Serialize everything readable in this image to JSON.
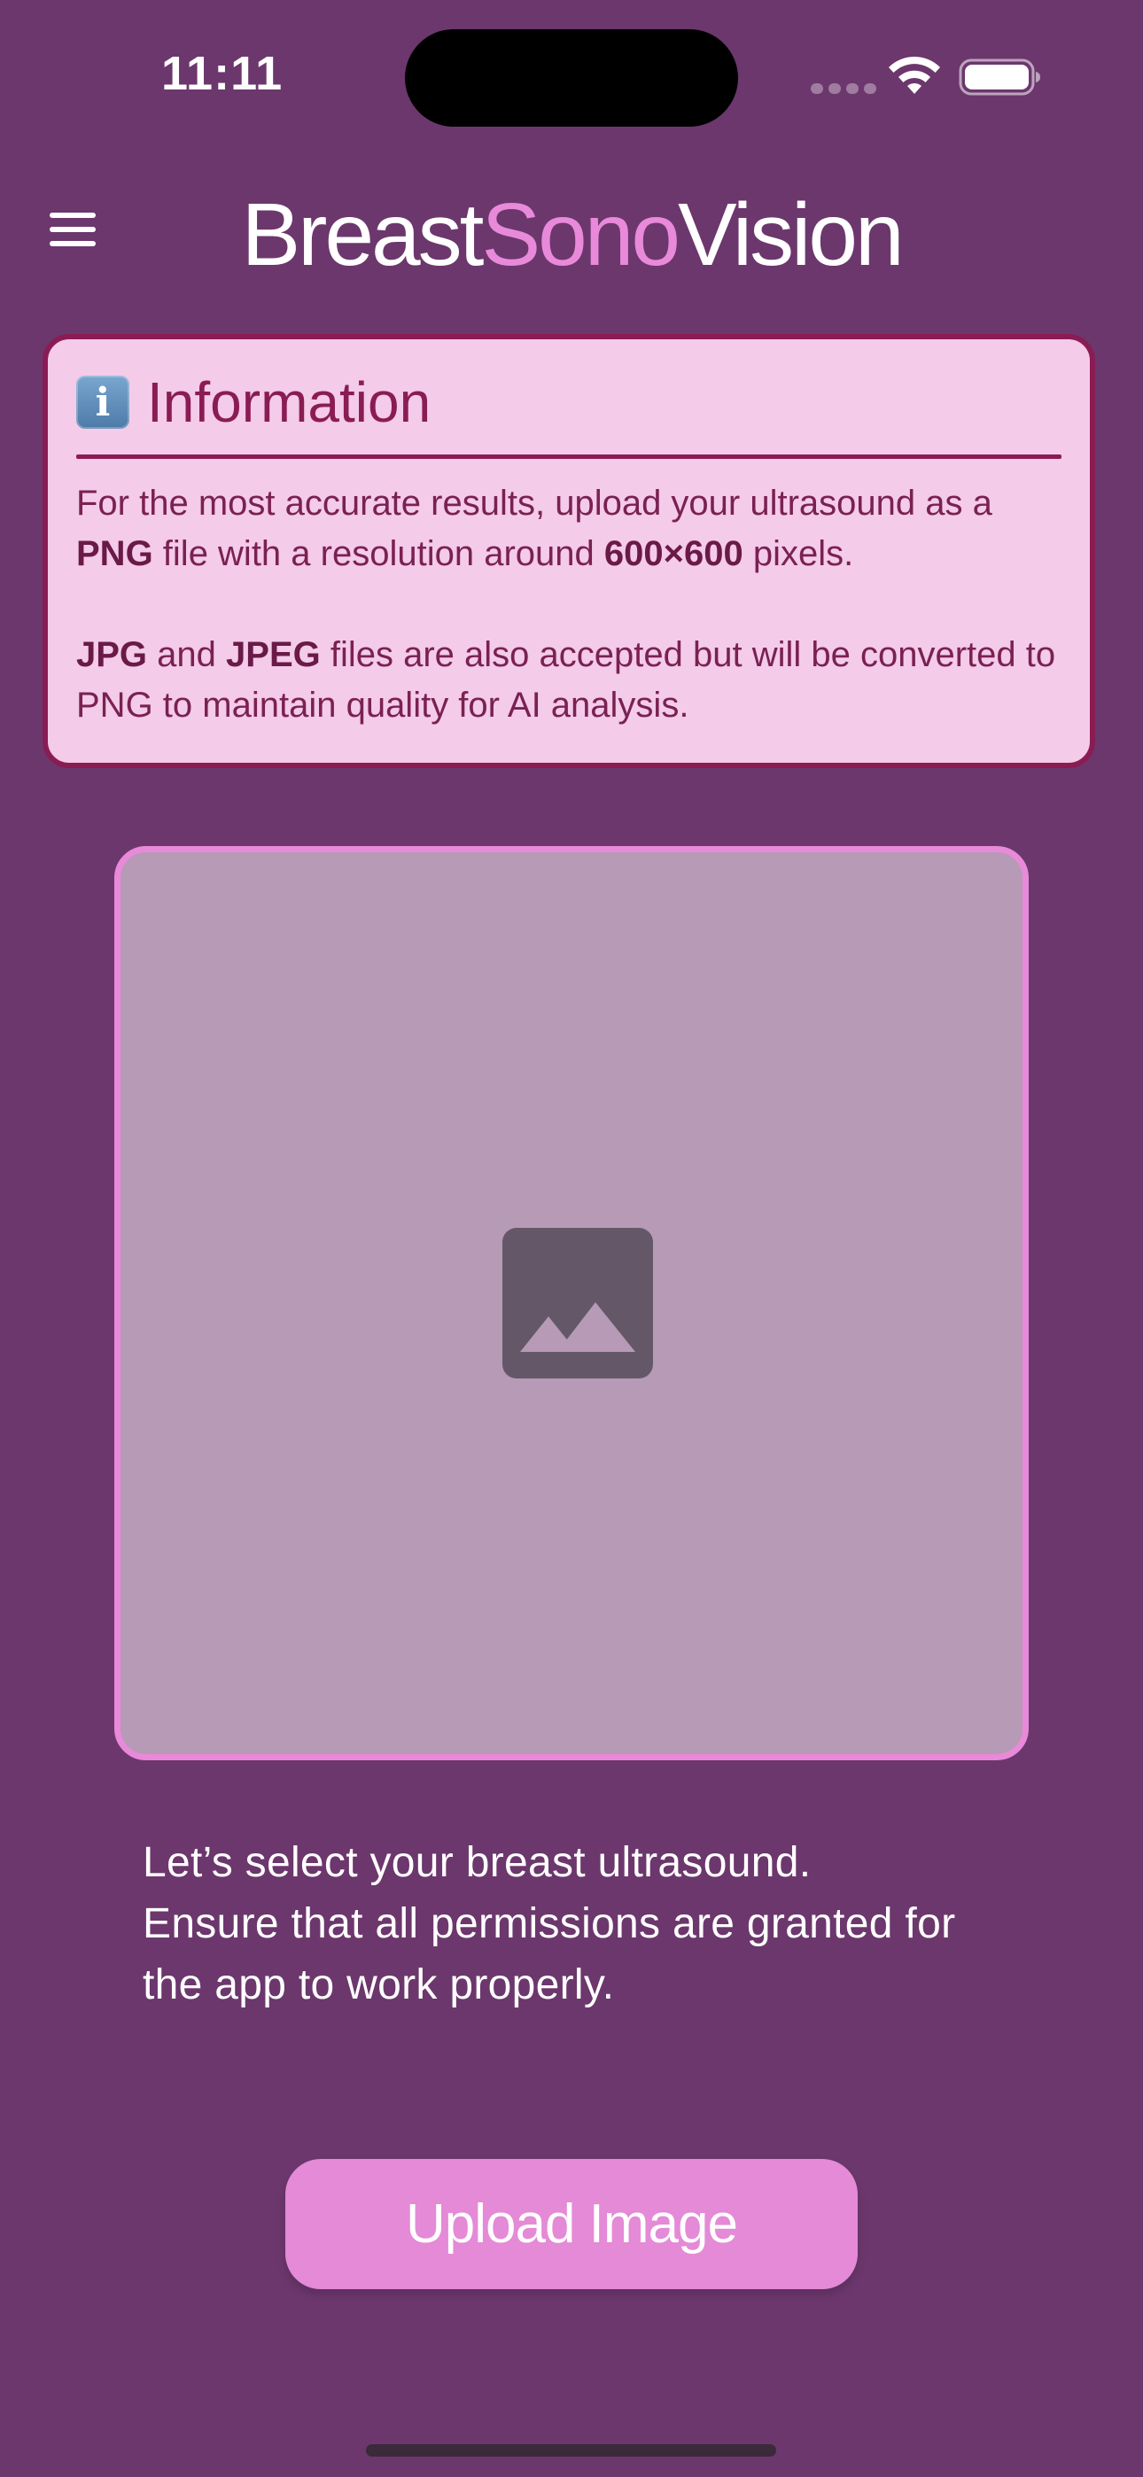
{
  "status_bar": {
    "time": "11:11"
  },
  "header": {
    "title_part1": "Breast",
    "title_part2": "Sono",
    "title_part3": "Vision",
    "menu_icon": "hamburger-menu-icon"
  },
  "info_card": {
    "icon": "information-icon",
    "icon_glyph": "i",
    "title": "Information",
    "p1_a": "For the most accurate results, upload your ultrasound as a ",
    "p1_b": "PNG",
    "p1_c": " file with a resolution around ",
    "p1_d": "600×600",
    "p1_e": " pixels.",
    "p2_a": "JPG",
    "p2_b": " and ",
    "p2_c": "JPEG",
    "p2_d": " files are also accepted but will be converted to PNG to maintain quality for AI analysis."
  },
  "image_placeholder": {
    "icon": "image-placeholder-icon"
  },
  "instruction": {
    "line1": "Let’s select your breast ultrasound.",
    "line2": "Ensure that all permissions are granted for",
    "line3": "the app to work properly."
  },
  "upload_button": {
    "label": "Upload Image"
  },
  "colors": {
    "background": "#6c376d",
    "accent_pink": "#e88ad9",
    "card_background": "#f4cbe9",
    "card_border": "#8a1c54",
    "placeholder_background": "#b69ab6",
    "button_background": "#e48ad6"
  }
}
